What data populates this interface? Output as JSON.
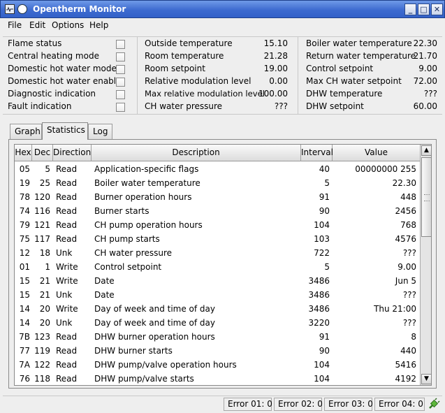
{
  "window": {
    "title": "Opentherm Monitor"
  },
  "menu": [
    "File",
    "Edit",
    "Options",
    "Help"
  ],
  "flags": [
    {
      "label": "Flame status",
      "checked": false
    },
    {
      "label": "Central heating mode",
      "checked": false
    },
    {
      "label": "Domestic hot water mode",
      "checked": false
    },
    {
      "label": "Domestic hot water enable",
      "checked": false
    },
    {
      "label": "Diagnostic indication",
      "checked": false
    },
    {
      "label": "Fault indication",
      "checked": false
    }
  ],
  "middle": [
    {
      "label": "Outside temperature",
      "value": "15.10"
    },
    {
      "label": "Room temperature",
      "value": "21.28"
    },
    {
      "label": "Room setpoint",
      "value": "19.00"
    },
    {
      "label": "Relative modulation level",
      "value": "0.00"
    },
    {
      "label": "Max relative modulation level",
      "value": "100.00"
    },
    {
      "label": "CH water pressure",
      "value": "???"
    }
  ],
  "right": [
    {
      "label": "Boiler water temperature",
      "value": "22.30"
    },
    {
      "label": "Return water temperature",
      "value": "21.70"
    },
    {
      "label": "Control setpoint",
      "value": "9.00"
    },
    {
      "label": "Max CH water setpoint",
      "value": "72.00"
    },
    {
      "label": "DHW temperature",
      "value": "???"
    },
    {
      "label": "DHW setpoint",
      "value": "60.00"
    }
  ],
  "tabs": [
    {
      "label": "Graph",
      "active": false
    },
    {
      "label": "Statistics",
      "active": true
    },
    {
      "label": "Log",
      "active": false
    }
  ],
  "table": {
    "headers": [
      "Hex",
      "Dec",
      "Direction",
      "Description",
      "Interval",
      "Value"
    ],
    "rows": [
      [
        "05",
        "5",
        "Read",
        "Application-specific flags",
        "40",
        "00000000 255"
      ],
      [
        "19",
        "25",
        "Read",
        "Boiler water temperature",
        "5",
        "22.30"
      ],
      [
        "78",
        "120",
        "Read",
        "Burner operation hours",
        "91",
        "448"
      ],
      [
        "74",
        "116",
        "Read",
        "Burner starts",
        "90",
        "2456"
      ],
      [
        "79",
        "121",
        "Read",
        "CH pump operation hours",
        "104",
        "768"
      ],
      [
        "75",
        "117",
        "Read",
        "CH pump starts",
        "103",
        "4576"
      ],
      [
        "12",
        "18",
        "Unk",
        "CH water pressure",
        "722",
        "???"
      ],
      [
        "01",
        "1",
        "Write",
        "Control setpoint",
        "5",
        "9.00"
      ],
      [
        "15",
        "21",
        "Write",
        "Date",
        "3486",
        "Jun 5"
      ],
      [
        "15",
        "21",
        "Unk",
        "Date",
        "3486",
        "???"
      ],
      [
        "14",
        "20",
        "Write",
        "Day of week and time of day",
        "3486",
        "Thu 21:00"
      ],
      [
        "14",
        "20",
        "Unk",
        "Day of week and time of day",
        "3220",
        "???"
      ],
      [
        "7B",
        "123",
        "Read",
        "DHW burner operation hours",
        "91",
        "8"
      ],
      [
        "77",
        "119",
        "Read",
        "DHW burner starts",
        "90",
        "440"
      ],
      [
        "7A",
        "122",
        "Read",
        "DHW pump/valve operation hours",
        "104",
        "5416"
      ],
      [
        "76",
        "118",
        "Read",
        "DHW pump/valve starts",
        "104",
        "4192"
      ]
    ]
  },
  "statusbar": {
    "errors": [
      "Error 01:  0",
      "Error 02:  0",
      "Error 03:  0",
      "Error 04:  0"
    ],
    "connection_icon": "plug-connected-icon"
  },
  "colors": {
    "titlebar": "#3e6bd0",
    "background": "#eeeeee"
  }
}
